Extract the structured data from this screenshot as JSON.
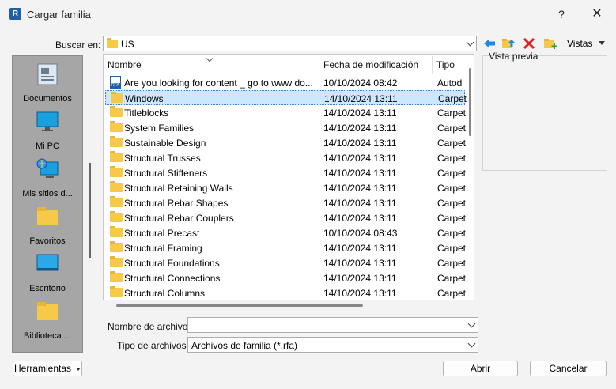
{
  "window": {
    "app_icon": "R",
    "title": "Cargar familia",
    "help_label": "?",
    "close_label": "✕"
  },
  "lookin": {
    "label": "Buscar en:",
    "value": "US"
  },
  "toolbar": {
    "back_icon": "back-arrow-icon",
    "up_icon": "folder-up-icon",
    "delete_icon": "delete-x-icon",
    "new_folder_icon": "new-folder-icon",
    "views_label": "Vistas"
  },
  "places": [
    {
      "label": "Documentos",
      "icon": "documents-icon"
    },
    {
      "label": "Mi PC",
      "icon": "monitor-icon"
    },
    {
      "label": "Mis sitios d...",
      "icon": "network-places-icon"
    },
    {
      "label": "Favoritos",
      "icon": "folder-icon"
    },
    {
      "label": "Escritorio",
      "icon": "desktop-icon"
    },
    {
      "label": "Biblioteca ...",
      "icon": "folder-icon"
    }
  ],
  "columns": {
    "name": "Nombre",
    "modified": "Fecha de modificación",
    "type": "Tipo"
  },
  "files": [
    {
      "name": "Are you looking for content _ go to www do...",
      "date": "10/10/2024 08:42",
      "type": "Autod",
      "kind": "rfa"
    },
    {
      "name": "Windows",
      "date": "14/10/2024 13:11",
      "type": "Carpet",
      "kind": "folder",
      "selected": true
    },
    {
      "name": "Titleblocks",
      "date": "14/10/2024 13:11",
      "type": "Carpet",
      "kind": "folder"
    },
    {
      "name": "System Families",
      "date": "14/10/2024 13:11",
      "type": "Carpet",
      "kind": "folder"
    },
    {
      "name": "Sustainable Design",
      "date": "14/10/2024 13:11",
      "type": "Carpet",
      "kind": "folder"
    },
    {
      "name": "Structural Trusses",
      "date": "14/10/2024 13:11",
      "type": "Carpet",
      "kind": "folder"
    },
    {
      "name": "Structural Stiffeners",
      "date": "14/10/2024 13:11",
      "type": "Carpet",
      "kind": "folder"
    },
    {
      "name": "Structural Retaining Walls",
      "date": "14/10/2024 13:11",
      "type": "Carpet",
      "kind": "folder"
    },
    {
      "name": "Structural Rebar Shapes",
      "date": "14/10/2024 13:11",
      "type": "Carpet",
      "kind": "folder"
    },
    {
      "name": "Structural Rebar Couplers",
      "date": "14/10/2024 13:11",
      "type": "Carpet",
      "kind": "folder"
    },
    {
      "name": "Structural Precast",
      "date": "10/10/2024 08:43",
      "type": "Carpet",
      "kind": "folder"
    },
    {
      "name": "Structural Framing",
      "date": "14/10/2024 13:11",
      "type": "Carpet",
      "kind": "folder"
    },
    {
      "name": "Structural Foundations",
      "date": "14/10/2024 13:11",
      "type": "Carpet",
      "kind": "folder"
    },
    {
      "name": "Structural Connections",
      "date": "14/10/2024 13:11",
      "type": "Carpet",
      "kind": "folder"
    },
    {
      "name": "Structural Columns",
      "date": "14/10/2024 13:11",
      "type": "Carpet",
      "kind": "folder"
    }
  ],
  "preview": {
    "label": "Vista previa"
  },
  "filename": {
    "label": "Nombre de archivo:",
    "value": ""
  },
  "filetype": {
    "label": "Tipo de archivos:",
    "value": "Archivos de familia (*.rfa)"
  },
  "buttons": {
    "tools": "Herramientas",
    "open": "Abrir",
    "cancel": "Cancelar"
  },
  "colors": {
    "selection": "#cce8ff",
    "folder": "#f7c948",
    "places_bg": "#a6a6a6"
  }
}
